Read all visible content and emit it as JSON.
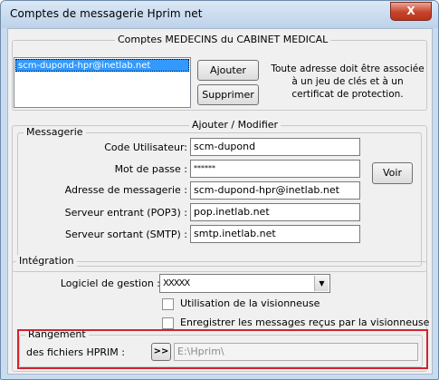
{
  "window": {
    "title": "Comptes de messagerie Hprim net",
    "close_glyph": "X"
  },
  "accounts": {
    "legend": "Comptes MEDECINS du CABINET MEDICAL",
    "items": [
      "scm-dupond-hpr@inetlab.net"
    ],
    "add_label": "Ajouter",
    "remove_label": "Supprimer",
    "note": "Toute adresse doit être associée à un jeu de clés et à un certificat de protection."
  },
  "edit": {
    "legend": "Ajouter / Modifier",
    "messaging_legend": "Messagerie",
    "user_code_label": "Code Utilisateur:",
    "user_code_value": "scm-dupond",
    "password_label": "Mot de passe :",
    "password_value": "******",
    "show_label": "Voir",
    "email_label": "Adresse de messagerie :",
    "email_value": "scm-dupond-hpr@inetlab.net",
    "pop3_label": "Serveur entrant (POP3) :",
    "pop3_value": "pop.inetlab.net",
    "smtp_label": "Serveur sortant (SMTP) :",
    "smtp_value": "smtp.inetlab.net"
  },
  "integration": {
    "legend": "Intégration",
    "software_label": "Logiciel de gestion :",
    "software_value": "XXXXX",
    "viewer_label": "Utilisation de la visionneuse",
    "save_label": "Enregistrer les messages reçus par la visionneuse",
    "storage_legend": "Rangement",
    "hprim_label": "des fichiers HPRIM :",
    "browse_label": ">>",
    "path_value": "E:\\Hprim\\"
  },
  "colors": {
    "highlight_box": "#d0242f",
    "selection": "#3399ff"
  }
}
